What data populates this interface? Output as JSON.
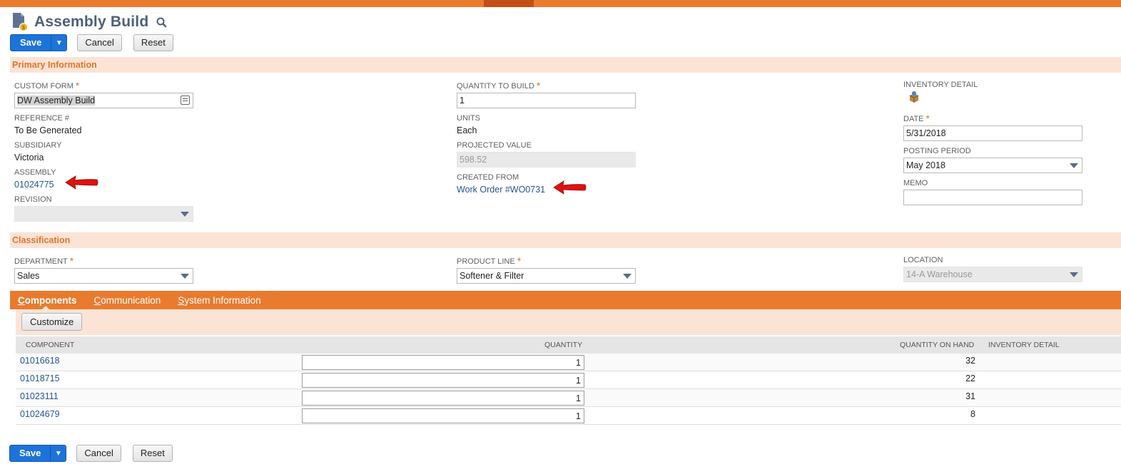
{
  "page": {
    "title": "Assembly Build",
    "icons": {
      "page": "document-icon",
      "search": "search-icon"
    }
  },
  "toolbar": {
    "save_label": "Save",
    "save_menu_glyph": "▼",
    "cancel_label": "Cancel",
    "reset_label": "Reset"
  },
  "primary": {
    "section_title": "Primary Information",
    "custom_form": {
      "label": "CUSTOM FORM",
      "value": "DW Assembly Build",
      "required": true
    },
    "reference": {
      "label": "REFERENCE #",
      "value": "To Be Generated"
    },
    "subsidiary": {
      "label": "SUBSIDIARY",
      "value": "Victoria"
    },
    "assembly": {
      "label": "ASSEMBLY",
      "value": "01024775"
    },
    "revision": {
      "label": "REVISION",
      "value": ""
    },
    "quantity_to_build": {
      "label": "QUANTITY TO BUILD",
      "value": "1",
      "required": true
    },
    "units": {
      "label": "UNITS",
      "value": "Each"
    },
    "projected_value": {
      "label": "PROJECTED VALUE",
      "value": "598.52"
    },
    "created_from": {
      "label": "CREATED FROM",
      "value": "Work Order #WO0731"
    },
    "inventory_detail": {
      "label": "INVENTORY DETAIL"
    },
    "date": {
      "label": "DATE",
      "value": "5/31/2018",
      "required": true
    },
    "posting_period": {
      "label": "POSTING PERIOD",
      "value": "May 2018"
    },
    "memo": {
      "label": "MEMO",
      "value": ""
    },
    "required_mark": "*"
  },
  "classification": {
    "section_title": "Classification",
    "department": {
      "label": "DEPARTMENT",
      "value": "Sales",
      "required": true
    },
    "product_line": {
      "label": "PRODUCT LINE",
      "value": "Softener & Filter",
      "required": true
    },
    "location": {
      "label": "LOCATION",
      "value": "14-A Warehouse"
    }
  },
  "tabs": [
    {
      "first": "C",
      "rest": "omponents",
      "active": true
    },
    {
      "first": "C",
      "rest": "ommunication",
      "active": false
    },
    {
      "first": "S",
      "rest": "ystem Information",
      "active": false
    }
  ],
  "components": {
    "customize_label": "Customize",
    "columns": {
      "component": "COMPONENT",
      "quantity": "QUANTITY",
      "on_hand": "QUANTITY ON HAND",
      "inventory_detail": "INVENTORY DETAIL"
    },
    "rows": [
      {
        "component": "01016618",
        "quantity": "1",
        "on_hand": "32"
      },
      {
        "component": "01018715",
        "quantity": "1",
        "on_hand": "22"
      },
      {
        "component": "01023111",
        "quantity": "1",
        "on_hand": "31"
      },
      {
        "component": "01024679",
        "quantity": "1",
        "on_hand": "8"
      }
    ]
  },
  "colors": {
    "accent": "#e97b2e",
    "section_bg": "#fbe4d5",
    "save_blue": "#1d73d9",
    "link": "#255599",
    "arrow_red": "#e0120f"
  }
}
